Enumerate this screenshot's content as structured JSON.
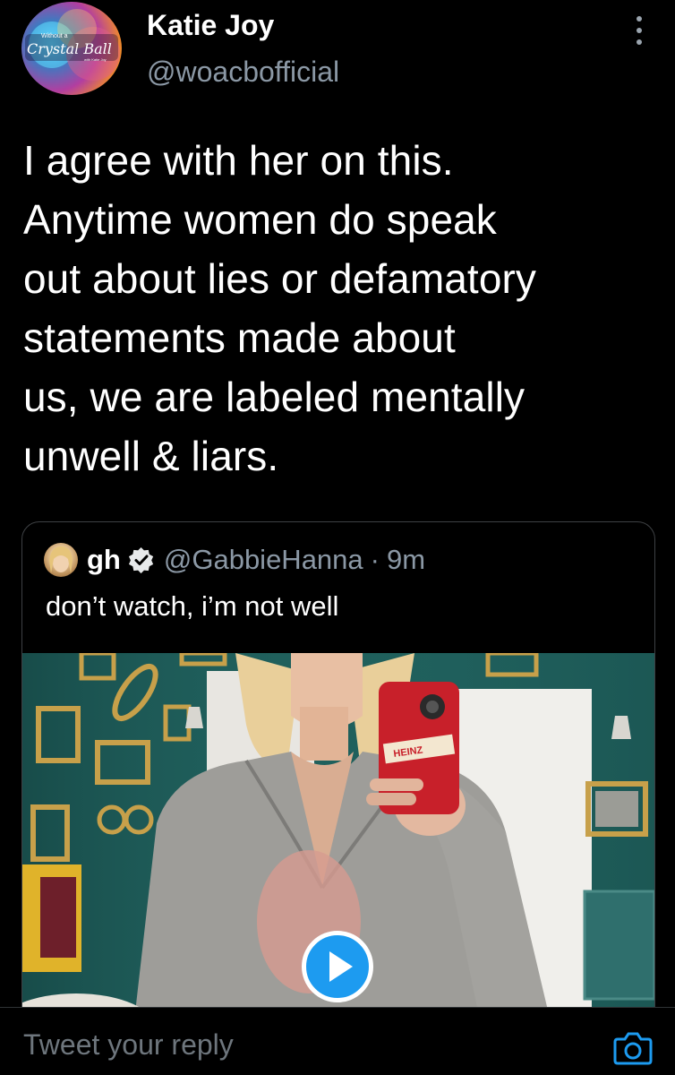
{
  "author": {
    "name": "Katie Joy",
    "handle": "@woacbofficial",
    "avatar_logo": {
      "small_top": "Without a",
      "title": "Crystal Ball",
      "small_bottom": "with Katie Joy"
    }
  },
  "tweet": {
    "lines": [
      "I agree with her on this.",
      "Anytime women do speak",
      "out about lies or defamatory",
      "statements made about",
      "us, we are labeled mentally",
      "unwell & liars."
    ]
  },
  "quoted_tweet": {
    "name": "gh",
    "handle": "@GabbieHanna",
    "separator": "·",
    "time": "9m",
    "text": "don’t watch, i’m not well",
    "media": {
      "type": "video",
      "phone_case_text": "HEINZ"
    }
  },
  "reply": {
    "placeholder": "Tweet your reply"
  },
  "icons": {
    "more": "more-vertical-icon",
    "verified": "verified-badge-icon",
    "play": "play-icon",
    "camera": "camera-icon"
  },
  "colors": {
    "background": "#000000",
    "text_primary": "#ffffff",
    "text_secondary": "#8b98a5",
    "accent": "#1d9bf0",
    "border": "#3e4144"
  }
}
